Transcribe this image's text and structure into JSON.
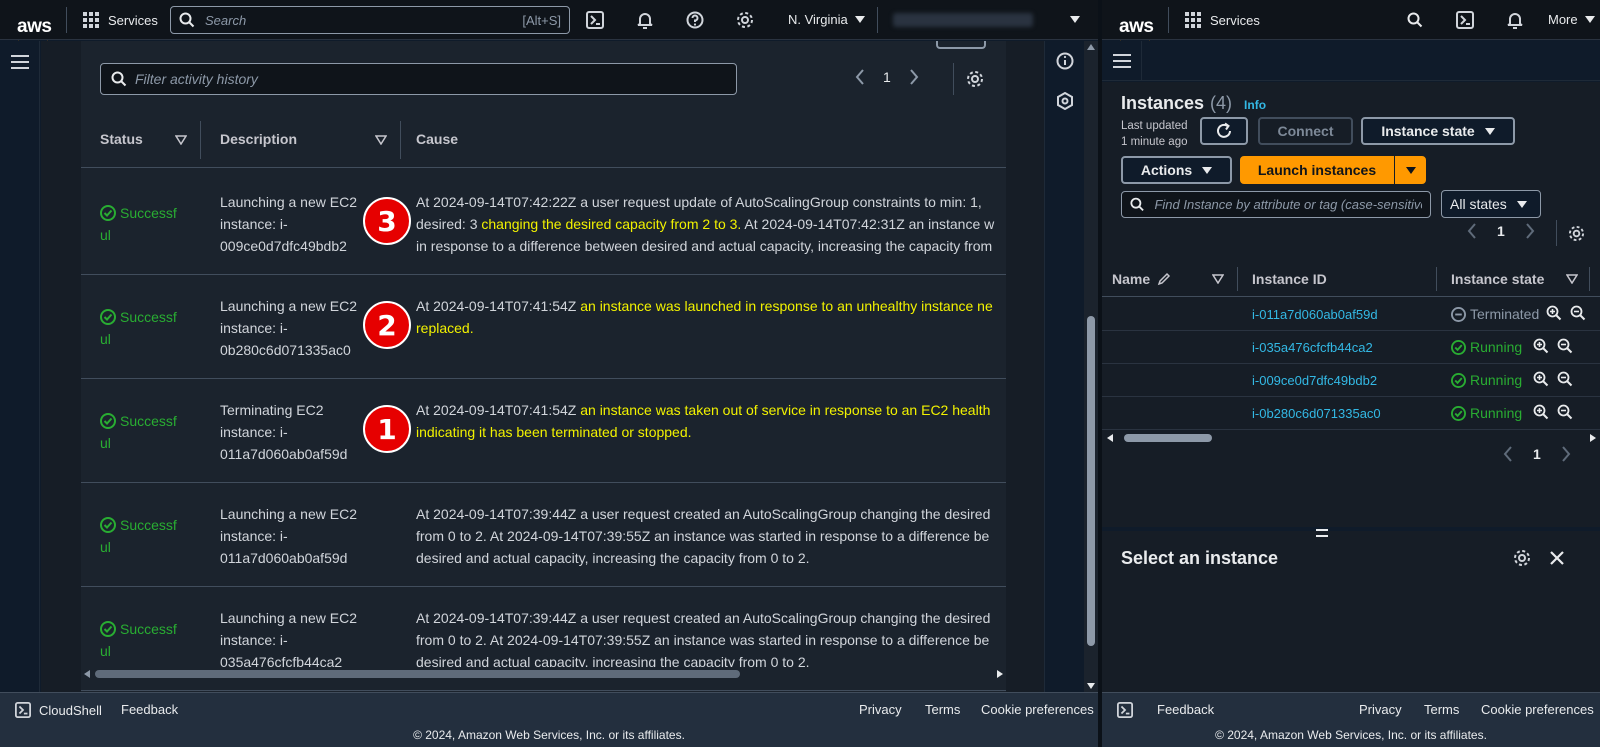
{
  "left_nav": {
    "logo": "aws",
    "services": "Services",
    "search_placeholder": "Search",
    "search_shortcut": "[Alt+S]",
    "region": "N. Virginia"
  },
  "right_nav": {
    "logo": "aws",
    "services": "Services",
    "more": "More"
  },
  "activity": {
    "filter_placeholder": "Filter activity history",
    "page": "1",
    "columns": {
      "status": "Status",
      "description": "Description",
      "cause": "Cause"
    },
    "rows": [
      {
        "status_a": "Successf",
        "status_b": "ul",
        "desc": [
          "Launching a new EC2",
          "instance: i-",
          "009ce0d7dfc49bdb2"
        ],
        "badge": "3",
        "cause_l1": "At 2024-09-14T07:42:22Z a user request update of AutoScalingGroup constraints to min: 1,",
        "cause_l2_a": "desired: 3 ",
        "cause_l2_hl": "changing the desired capacity from 2 to 3.",
        "cause_l2_b": " At 2024-09-14T07:42:31Z an instance w",
        "cause_l3": "in response to a difference between desired and actual capacity, increasing the capacity from"
      },
      {
        "status_a": "Successf",
        "status_b": "ul",
        "desc": [
          "Launching a new EC2",
          "instance: i-",
          "0b280c6d071335ac0"
        ],
        "badge": "2",
        "cause_l1_a": "At 2024-09-14T07:41:54Z ",
        "cause_l1_hl": "an instance was launched in response to an unhealthy instance ne",
        "cause_l2_hl": "replaced."
      },
      {
        "status_a": "Successf",
        "status_b": "ul",
        "desc": [
          "Terminating EC2",
          "instance: i-",
          "011a7d060ab0af59d"
        ],
        "badge": "1",
        "cause_l1_a": "At 2024-09-14T07:41:54Z ",
        "cause_l1_hl": "an instance was taken out of service in response to an EC2 health",
        "cause_l2_hl": "indicating it has been terminated or stopped."
      },
      {
        "status_a": "Successf",
        "status_b": "ul",
        "desc": [
          "Launching a new EC2",
          "instance: i-",
          "011a7d060ab0af59d"
        ],
        "cause_l1": "At 2024-09-14T07:39:44Z a user request created an AutoScalingGroup changing the desired",
        "cause_l2": "from 0 to 2. At 2024-09-14T07:39:55Z an instance was started in response to a difference be",
        "cause_l3": "desired and actual capacity, increasing the capacity from 0 to 2."
      },
      {
        "status_a": "Successf",
        "status_b": "ul",
        "desc": [
          "Launching a new EC2",
          "instance: i-",
          "035a476cfcfb44ca2"
        ],
        "cause_l1": "At 2024-09-14T07:39:44Z a user request created an AutoScalingGroup changing the desired",
        "cause_l2": "from 0 to 2. At 2024-09-14T07:39:55Z an instance was started in response to a difference be",
        "cause_l3": "desired and actual capacity, increasing the capacity from 0 to 2."
      }
    ]
  },
  "instances": {
    "title": "Instances",
    "count": "(4)",
    "info": "Info",
    "last_updated_l1": "Last updated",
    "last_updated_l2": "1 minute ago",
    "connect": "Connect",
    "instance_state": "Instance state",
    "actions": "Actions",
    "launch": "Launch instances",
    "find_placeholder": "Find Instance by attribute or tag (case-sensitive)",
    "all_states": "All states",
    "page": "1",
    "columns": {
      "name": "Name",
      "id": "Instance ID",
      "state": "Instance state"
    },
    "rows": [
      {
        "id": "i-011a7d060ab0af59d",
        "state": "Terminated"
      },
      {
        "id": "i-035a476cfcfb44ca2",
        "state": "Running"
      },
      {
        "id": "i-009ce0d7dfc49bdb2",
        "state": "Running"
      },
      {
        "id": "i-0b280c6d071335ac0",
        "state": "Running"
      }
    ],
    "bottom_page": "1",
    "select_title": "Select an instance"
  },
  "footer_left": {
    "cloudshell": "CloudShell",
    "feedback": "Feedback",
    "privacy": "Privacy",
    "terms": "Terms",
    "cookie": "Cookie preferences",
    "copyright": "© 2024, Amazon Web Services, Inc. or its affiliates."
  },
  "footer_right": {
    "feedback": "Feedback",
    "privacy": "Privacy",
    "terms": "Terms",
    "cookie": "Cookie preferences",
    "copyright": "© 2024, Amazon Web Services, Inc. or its affiliates."
  },
  "colors": {
    "accent_orange": "#ff9900",
    "success_green": "#29ad32",
    "link_blue": "#33b9e5",
    "highlight_yellow": "#f2f200",
    "badge_red": "#e60000"
  }
}
